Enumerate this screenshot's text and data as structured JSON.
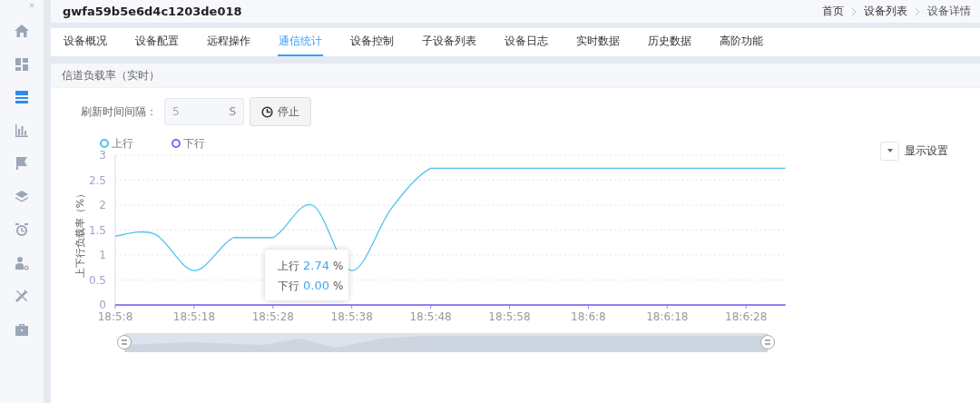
{
  "sidebar": {
    "collapse_glyph": "»",
    "items": [
      {
        "kind": "home",
        "selected": false
      },
      {
        "kind": "grid",
        "selected": false
      },
      {
        "kind": "list",
        "selected": true
      },
      {
        "kind": "bars",
        "selected": false
      },
      {
        "kind": "flag",
        "selected": false
      },
      {
        "kind": "layers",
        "selected": false
      },
      {
        "kind": "clock",
        "selected": false
      },
      {
        "kind": "user",
        "selected": false
      },
      {
        "kind": "tools",
        "selected": false
      },
      {
        "kind": "case",
        "selected": false
      }
    ]
  },
  "header": {
    "title": "gwfa59b5e6d4c1203de018",
    "breadcrumb": [
      "首页",
      "设备列表",
      "设备详情"
    ]
  },
  "tabs": [
    {
      "label": "设备概况",
      "selected": false
    },
    {
      "label": "设备配置",
      "selected": false
    },
    {
      "label": "远程操作",
      "selected": false
    },
    {
      "label": "通信统计",
      "selected": true
    },
    {
      "label": "设备控制",
      "selected": false
    },
    {
      "label": "子设备列表",
      "selected": false
    },
    {
      "label": "设备日志",
      "selected": false
    },
    {
      "label": "实时数据",
      "selected": false
    },
    {
      "label": "历史数据",
      "selected": false
    },
    {
      "label": "高阶功能",
      "selected": false
    }
  ],
  "section": {
    "title": "信道负载率（实时）"
  },
  "refresh": {
    "label": "刷新时间间隔：",
    "value": "5",
    "unit": "S",
    "button": "停止"
  },
  "display_settings": "显示设置",
  "chart_data": {
    "type": "line",
    "ylabel": "上下行负载率（%）",
    "categories": [
      "18:5:8",
      null,
      "18:5:18",
      null,
      "18:5:28",
      null,
      "18:5:38",
      null,
      "18:5:48",
      null,
      "18:5:58",
      null,
      "18:6:8",
      null,
      "18:6:18",
      null,
      "18:6:28",
      null
    ],
    "grid": true,
    "series": [
      {
        "name": "上行",
        "color": "#4dc4ee",
        "values": [
          1.38,
          1.42,
          0.69,
          1.35,
          1.35,
          2.0,
          0.69,
          1.93,
          2.74,
          2.74,
          2.74,
          2.74,
          2.74,
          2.74,
          2.74,
          2.74,
          2.74,
          2.74
        ]
      },
      {
        "name": "下行",
        "color": "#7c6cf2",
        "values": [
          0,
          0,
          0,
          0,
          0,
          0,
          0,
          0,
          0,
          0,
          0,
          0,
          0,
          0,
          0,
          0,
          0,
          0
        ]
      }
    ],
    "ylim": [
      0,
      3
    ],
    "yticks": [
      0,
      0.5,
      1,
      1.5,
      2,
      2.5,
      3
    ]
  },
  "tooltip": {
    "rows": [
      {
        "name": "上行",
        "value": "2.74",
        "unit": "%"
      },
      {
        "name": "下行",
        "value": "0.00",
        "unit": "%"
      }
    ]
  }
}
